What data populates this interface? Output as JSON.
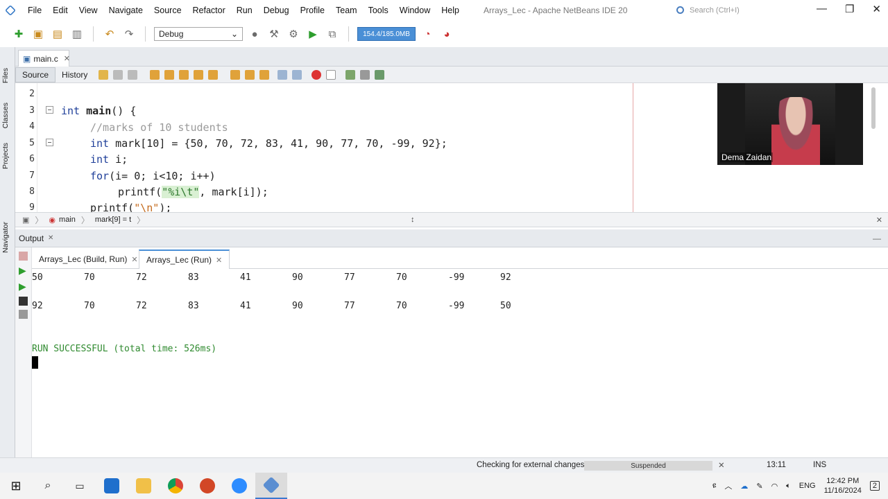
{
  "window": {
    "title": "Arrays_Lec - Apache NetBeans IDE 20",
    "search_placeholder": "Search (Ctrl+I)",
    "min": "—",
    "max": "❐",
    "close": "✕"
  },
  "menu": [
    "File",
    "Edit",
    "View",
    "Navigate",
    "Source",
    "Refactor",
    "Run",
    "Debug",
    "Profile",
    "Team",
    "Tools",
    "Window",
    "Help"
  ],
  "toolbar": {
    "config": "Debug",
    "memory": "154.4/185.0MB"
  },
  "side_tabs": [
    "Files",
    "Classes",
    "Projects",
    "Navigator"
  ],
  "editor": {
    "tab_label": "main.c",
    "source_tab": "Source",
    "history_tab": "History",
    "line_numbers": [
      "2",
      "3",
      "4",
      "5",
      "6",
      "7",
      "8",
      "9"
    ],
    "lines": {
      "l3_kw": "int",
      "l3_fn": "main",
      "l3_rest": "() {",
      "l4": "//marks of 10 students",
      "l5_kw": "int",
      "l5_rest": " mark[10] = {50, 70, 72, 83, 41, 90, 77, 70, -99, 92};",
      "l6_kw": "int",
      "l6_rest": " i;",
      "l7_kw": "for",
      "l7_rest": "(i= 0; i<10; i++)",
      "l8_a": "printf(",
      "l8_str": "\"%i\\t\"",
      "l8_b": ", mark[i]);",
      "l9_a": "printf(",
      "l9_str": "\"\\n\"",
      "l9_b": ");"
    }
  },
  "video": {
    "name": "Dema Zaidan"
  },
  "breadcrumb": {
    "fn": "main",
    "item": "mark[9] = t"
  },
  "output": {
    "title": "Output",
    "tabs": [
      "Arrays_Lec (Build, Run)",
      "Arrays_Lec (Run)"
    ],
    "row1": [
      "50",
      "70",
      "72",
      "83",
      "41",
      "90",
      "77",
      "70",
      "-99",
      "92"
    ],
    "row2": [
      "92",
      "70",
      "72",
      "83",
      "41",
      "90",
      "77",
      "70",
      "-99",
      "50"
    ],
    "result": "RUN SUCCESSFUL (total time: 526ms)"
  },
  "status": {
    "message": "Checking for external changes",
    "progress_label": "Suspended",
    "position": "13:11",
    "mode": "INS"
  },
  "taskbar": {
    "time": "12:42 PM",
    "date": "11/16/2024",
    "lang": "ENG",
    "notif": "2",
    "apps": [
      "start",
      "search",
      "task-view",
      "mail",
      "explorer",
      "chrome",
      "powerpoint",
      "zoom",
      "netbeans"
    ]
  }
}
